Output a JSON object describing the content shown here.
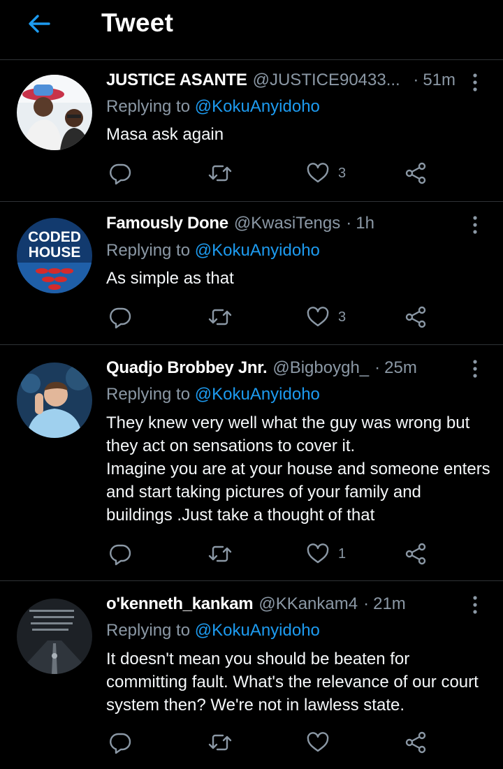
{
  "header": {
    "title": "Tweet",
    "back_icon": "arrow-left-icon",
    "accent": "#1d9bf0"
  },
  "colors": {
    "background": "#000000",
    "secondary_text": "#8b98a5",
    "link": "#1d9bf0",
    "divider": "#2f3336"
  },
  "replies": [
    {
      "name": "JUSTICE ASANTE",
      "handle": "@JUSTICE90433...",
      "sep": "·",
      "time": "51m",
      "replying_prefix": "Replying to ",
      "replying_to": "@KokuAnyidoho",
      "text": "Masa ask again",
      "likes": "3"
    },
    {
      "name": "Famously Done",
      "handle": "@KwasiTengs",
      "sep": "·",
      "time": "1h",
      "replying_prefix": "Replying to ",
      "replying_to": "@KokuAnyidoho",
      "text": "As simple as that",
      "likes": "3",
      "avatar_text_1": "CODED",
      "avatar_text_2": "HOUSE"
    },
    {
      "name": "Quadjo Brobbey Jnr.",
      "handle": "@Bigboygh_",
      "sep": "·",
      "time": "25m",
      "replying_prefix": "Replying to ",
      "replying_to": "@KokuAnyidoho",
      "text": "They knew very well what the guy was wrong but they act on sensations to cover it.\nImagine you are at your house and someone enters and start taking pictures of your family and buildings .Just take a thought of that",
      "likes": "1"
    },
    {
      "name": "o'kenneth_kankam",
      "handle": "@KKankam4",
      "sep": "·",
      "time": "21m",
      "replying_prefix": "Replying to ",
      "replying_to": "@KokuAnyidoho",
      "text": "It doesn't mean you should be beaten for committing fault. What's  the relevance of our court system then? We're not in lawless state.",
      "likes": ""
    }
  ],
  "icons": {
    "reply": "reply-icon",
    "retweet": "retweet-icon",
    "like": "heart-icon",
    "share": "share-icon",
    "more": "more-vertical-icon"
  }
}
